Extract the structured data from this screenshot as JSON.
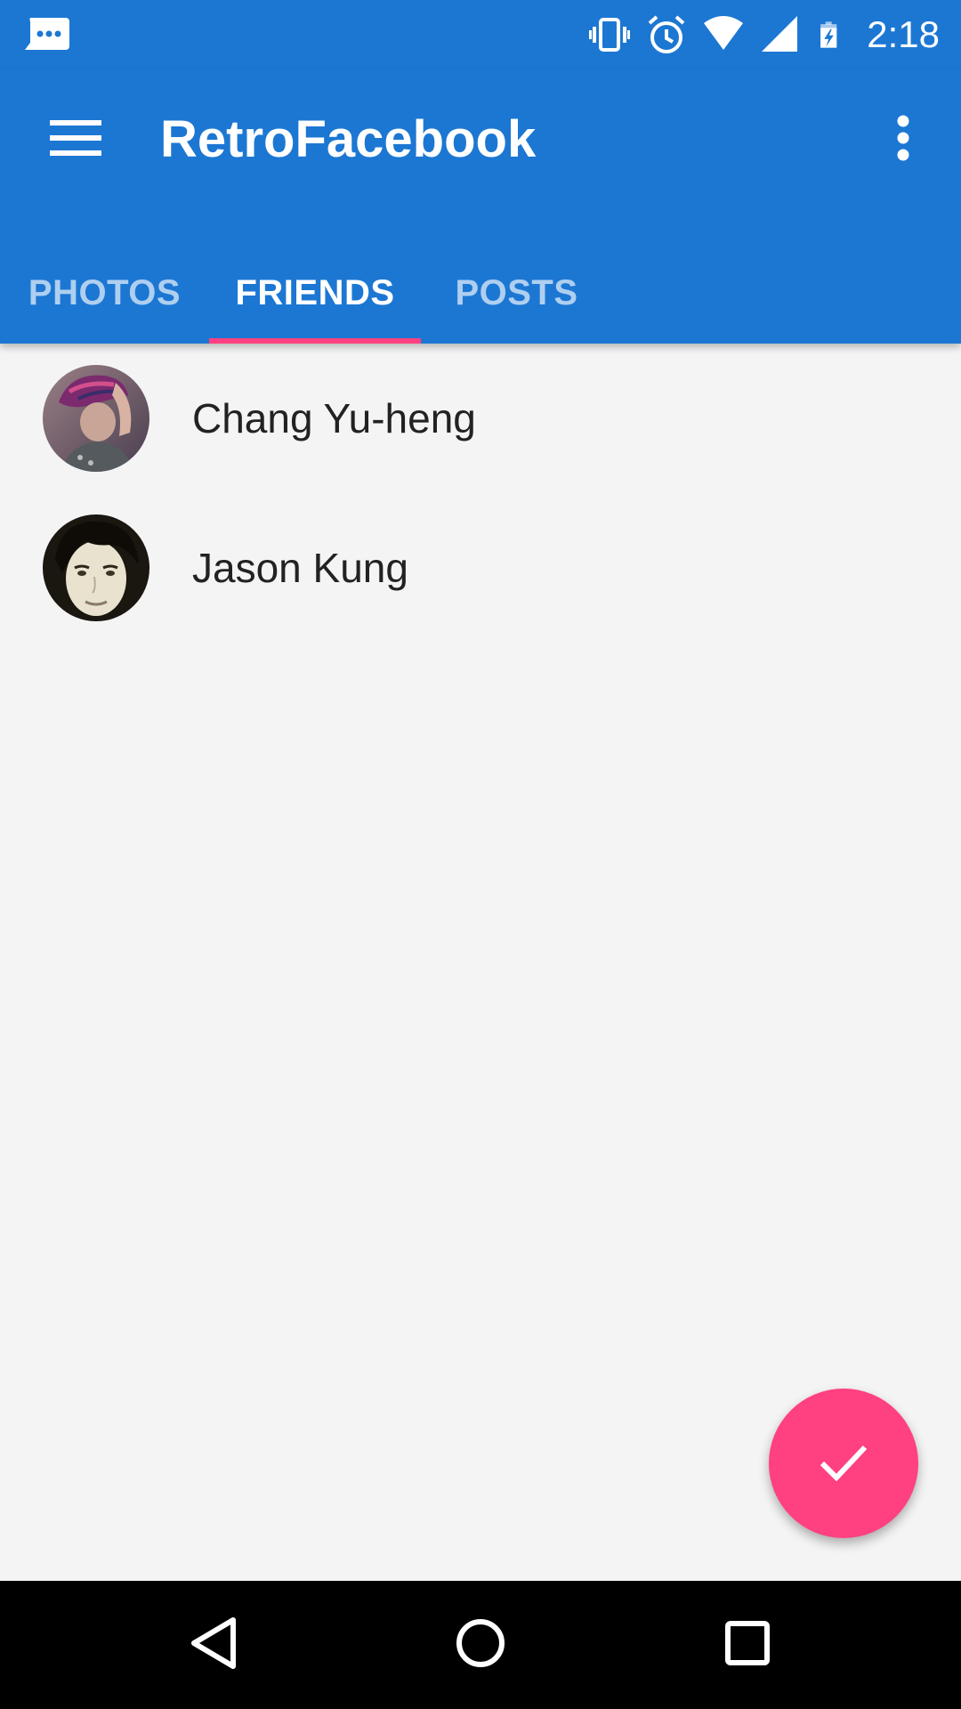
{
  "status_bar": {
    "time": "2:18",
    "icons": [
      "chat-bubble-icon",
      "vibrate-icon",
      "alarm-icon",
      "wifi-icon",
      "cell-signal-icon",
      "battery-charging-icon"
    ]
  },
  "app_bar": {
    "title": "RetroFacebook",
    "menu_icon": "hamburger-menu-icon",
    "overflow_icon": "more-vert-icon"
  },
  "tabs": [
    {
      "label": "PHOTOS",
      "active": false
    },
    {
      "label": "FRIENDS",
      "active": true
    },
    {
      "label": "POSTS",
      "active": false
    }
  ],
  "friends": [
    {
      "name": "Chang Yu-heng",
      "avatar": "avatar-photo"
    },
    {
      "name": "Jason Kung",
      "avatar": "avatar-photo"
    }
  ],
  "fab": {
    "icon": "check-icon"
  },
  "nav_bar": {
    "icons": [
      "back-icon",
      "home-icon",
      "recents-icon"
    ]
  },
  "colors": {
    "primary": "#1c77d3",
    "accent": "#ff4081",
    "background": "#f4f4f4",
    "nav_bar": "#000000"
  }
}
